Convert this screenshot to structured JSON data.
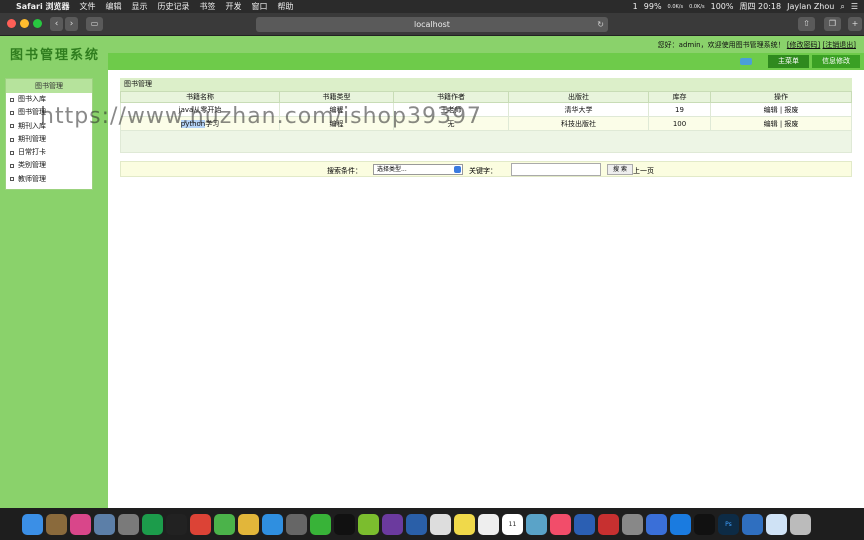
{
  "menubar": {
    "app": "Safari 浏览器",
    "items": [
      "文件",
      "编辑",
      "显示",
      "历史记录",
      "书签",
      "开发",
      "窗口",
      "帮助"
    ],
    "status": {
      "battery": "99%",
      "net_up": "0.0K/s",
      "net_down": "0.0K/s",
      "battery2": "100%",
      "datetime": "周四 20:18",
      "user": "Jaylan Zhou",
      "badge": "1"
    }
  },
  "browser": {
    "url": "localhost"
  },
  "header": {
    "logo": "图书管理系统",
    "welcome": "您好：admin，欢迎使用图书管理系统！",
    "link_change_pwd": "[修改密码]",
    "link_logout": "[注销退出]",
    "tab_main": "主菜单",
    "tab_info": "信息修改"
  },
  "sidebar": {
    "title": "图书管理",
    "items": [
      "图书入库",
      "图书管理",
      "期刊入库",
      "期刊管理",
      "日常打卡",
      "类别管理",
      "教师管理"
    ]
  },
  "main": {
    "breadcrumb": "图书管理",
    "columns": [
      "书籍名称",
      "书籍类型",
      "书籍作者",
      "出版社",
      "库存",
      "操作"
    ],
    "rows": [
      {
        "name": "java从零开始",
        "type": "编程",
        "author": "王老师",
        "publisher": "清华大学",
        "stock": "19",
        "edit": "编辑",
        "sep": "|",
        "scrap": "报废"
      },
      {
        "name_hl": "python",
        "name_rest": "学习",
        "type": "编程",
        "author": "无",
        "publisher": "科技出版社",
        "stock": "100",
        "edit": "编辑",
        "sep": "|",
        "scrap": "报废"
      }
    ]
  },
  "search": {
    "condition_label": "搜索条件：",
    "select_value": "选择类型...",
    "keyword_label": "关键字：",
    "button": "搜 索",
    "prev": "上一页"
  },
  "watermark": "https://www.huzhan.com/ishop39397",
  "dock": {
    "items": [
      "Finder",
      "Notes",
      "Photos",
      "Preview",
      "Launchpad",
      "PyCharm",
      "IntelliJ",
      "Chrome",
      "Evernote",
      "Squirrel",
      "Safari",
      "Terminal",
      "WeChat",
      "QQ",
      "Eclipse",
      "RP",
      "Xcode",
      "TextEdit",
      "Stickies",
      "Reminders",
      "Calendar",
      "Photos2",
      "Music",
      "Word",
      "Remote",
      "Prefs",
      "Baidu",
      "TeamViewer",
      "QQ2",
      "Photoshop",
      "Edge",
      "Files",
      "Trash"
    ],
    "calendar_day": "11"
  }
}
